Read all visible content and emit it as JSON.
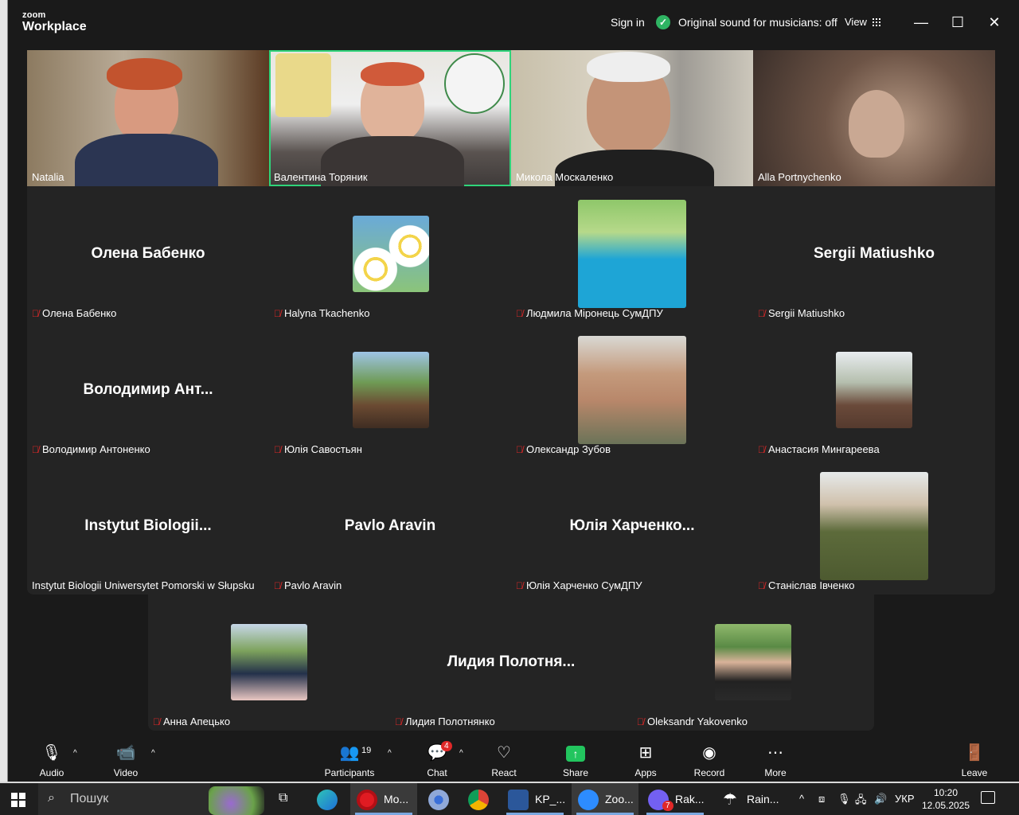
{
  "app": {
    "logo_line1": "zoom",
    "logo_line2": "Workplace",
    "sign_in": "Sign in",
    "original_sound": "Original sound for musicians: off",
    "view": "View"
  },
  "speakers": [
    {
      "name": "Natalia"
    },
    {
      "name": "Валентина Торяник"
    },
    {
      "name": "Микола Москаленко"
    },
    {
      "name": "Alla Portnychenko"
    }
  ],
  "grid": [
    {
      "name": "Олена Бабенко",
      "display": "Олена Бабенко",
      "muted": true
    },
    {
      "name": "Halyna Tkachenko",
      "display": "",
      "muted": true
    },
    {
      "name": "Людмила Міронець СумДПУ",
      "display": "",
      "muted": true
    },
    {
      "name": "Sergii Matiushko",
      "display": "Sergii Matiushko",
      "muted": true
    },
    {
      "name": "Володимир Антоненко",
      "display": "Володимир  Ант...",
      "muted": true
    },
    {
      "name": "Юлія Савостьян",
      "display": "",
      "muted": true
    },
    {
      "name": "Олександр Зубов",
      "display": "",
      "muted": true
    },
    {
      "name": "Анастасия Мингареева",
      "display": "",
      "muted": true
    },
    {
      "name": "Instytut Biologii Uniwersytet Pomorski w Słupsku",
      "display": "Instytut  Biologii...",
      "muted": false
    },
    {
      "name": "Pavlo Aravin",
      "display": "Pavlo Aravin",
      "muted": true
    },
    {
      "name": "Юлія Харченко СумДПУ",
      "display": "Юлія  Харченко...",
      "muted": true
    },
    {
      "name": "Станіслав Івченко",
      "display": "",
      "muted": true
    }
  ],
  "bottom": [
    {
      "name": "Анна Апецько",
      "display": "",
      "muted": true
    },
    {
      "name": "Лидия Полотнянко",
      "display": "Лидия  Полотня...",
      "muted": true
    },
    {
      "name": "Oleksandr Yakovenko",
      "display": "",
      "muted": true
    }
  ],
  "toolbar": {
    "audio": "Audio",
    "video": "Video",
    "participants": "Participants",
    "participants_count": "19",
    "chat": "Chat",
    "chat_badge": "4",
    "react": "React",
    "share": "Share",
    "apps": "Apps",
    "record": "Record",
    "more": "More",
    "leave": "Leave"
  },
  "taskbar": {
    "search_placeholder": "Пошук",
    "apps": [
      {
        "label": "Mo..."
      },
      {
        "label": ""
      },
      {
        "label": ""
      },
      {
        "label": "KP_..."
      },
      {
        "label": "Zoo..."
      },
      {
        "label": "Rak...",
        "badge": "7"
      },
      {
        "label": "Rain..."
      }
    ],
    "language": "УКР",
    "time": "10:20",
    "date": "12.05.2025"
  },
  "colors": {
    "background": "#1a1a1a",
    "tile": "#242424",
    "active_speaker": "#2fd47a",
    "mute": "#e02828",
    "share": "#22c55e"
  }
}
